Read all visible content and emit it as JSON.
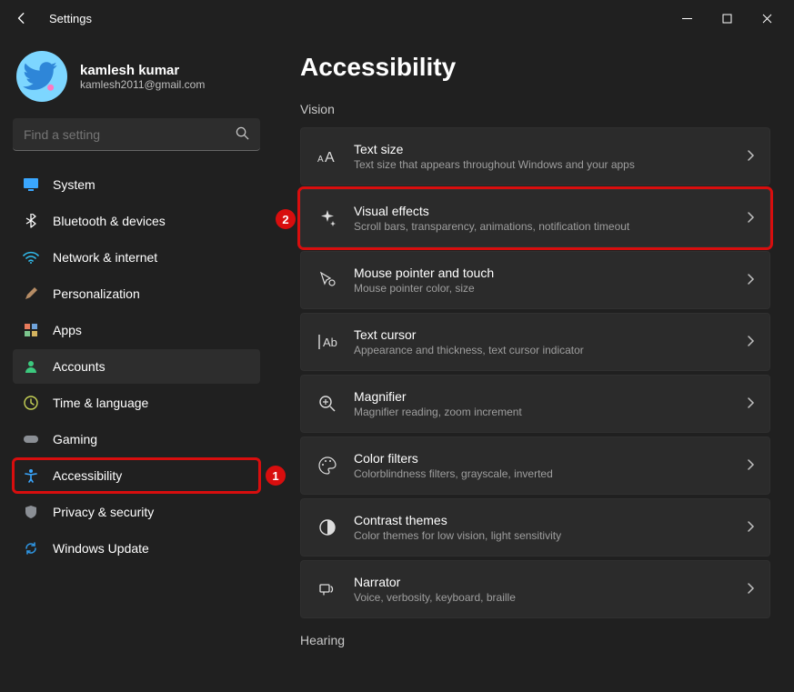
{
  "window": {
    "title": "Settings"
  },
  "profile": {
    "name": "kamlesh kumar",
    "email": "kamlesh2011@gmail.com"
  },
  "search": {
    "placeholder": "Find a setting"
  },
  "navItems": [
    {
      "label": "System"
    },
    {
      "label": "Bluetooth & devices"
    },
    {
      "label": "Network & internet"
    },
    {
      "label": "Personalization"
    },
    {
      "label": "Apps"
    },
    {
      "label": "Accounts"
    },
    {
      "label": "Time & language"
    },
    {
      "label": "Gaming"
    },
    {
      "label": "Accessibility"
    },
    {
      "label": "Privacy & security"
    },
    {
      "label": "Windows Update"
    }
  ],
  "page": {
    "title": "Accessibility"
  },
  "sections": {
    "vision": "Vision",
    "hearing": "Hearing"
  },
  "visionCards": [
    {
      "title": "Text size",
      "subtitle": "Text size that appears throughout Windows and your apps"
    },
    {
      "title": "Visual effects",
      "subtitle": "Scroll bars, transparency, animations, notification timeout"
    },
    {
      "title": "Mouse pointer and touch",
      "subtitle": "Mouse pointer color, size"
    },
    {
      "title": "Text cursor",
      "subtitle": "Appearance and thickness, text cursor indicator"
    },
    {
      "title": "Magnifier",
      "subtitle": "Magnifier reading, zoom increment"
    },
    {
      "title": "Color filters",
      "subtitle": "Colorblindness filters, grayscale, inverted"
    },
    {
      "title": "Contrast themes",
      "subtitle": "Color themes for low vision, light sensitivity"
    },
    {
      "title": "Narrator",
      "subtitle": "Voice, verbosity, keyboard, braille"
    }
  ],
  "annotations": {
    "nav": "1",
    "card": "2"
  }
}
